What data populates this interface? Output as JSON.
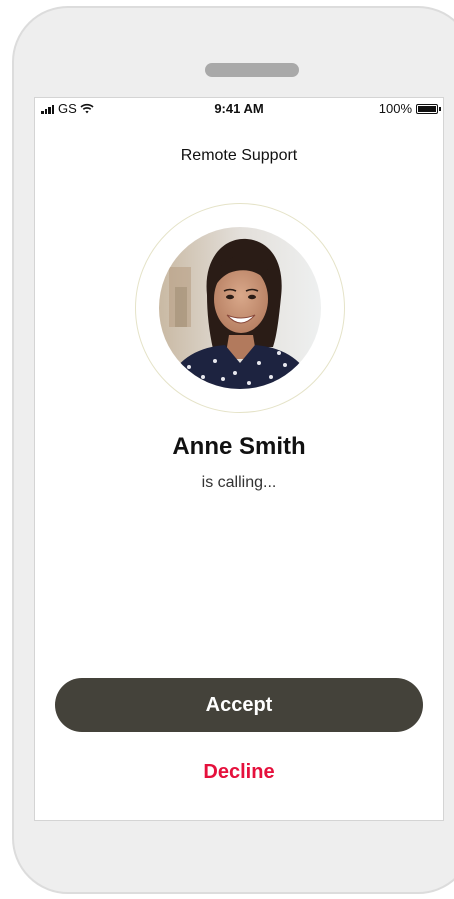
{
  "status_bar": {
    "carrier": "GS",
    "time": "9:41 AM",
    "battery": "100%",
    "battery_level": 1.0
  },
  "header": {
    "title": "Remote Support"
  },
  "caller": {
    "name": "Anne Smith",
    "status": "is calling..."
  },
  "actions": {
    "accept_label": "Accept",
    "decline_label": "Decline"
  },
  "colors": {
    "accept_bg": "#44423a",
    "decline_text": "#e5103c",
    "ring": "#e5e3c8"
  },
  "icons": {
    "signal": "cellular-signal-icon",
    "wifi": "wifi-icon",
    "battery": "battery-icon"
  }
}
